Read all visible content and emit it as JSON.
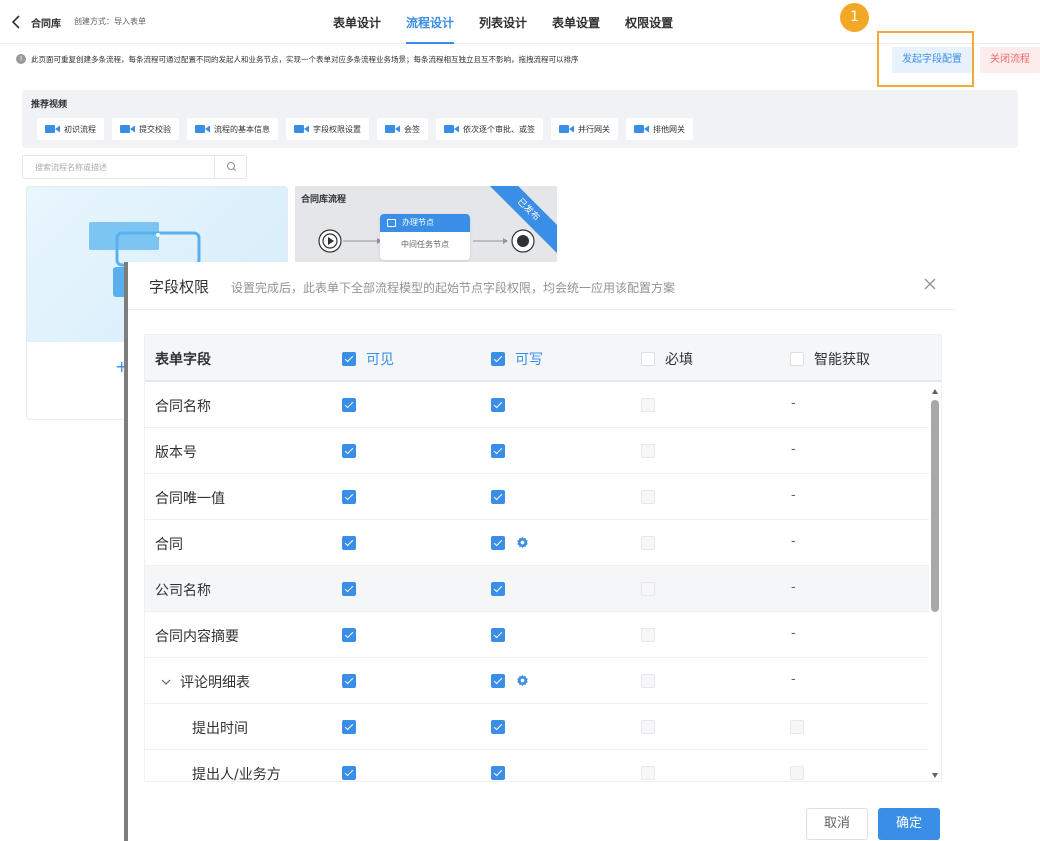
{
  "header": {
    "app_title": "合同库",
    "create_mode": "创建方式：导入表单",
    "tabs": [
      {
        "label": "表单设计",
        "active": false
      },
      {
        "label": "流程设计",
        "active": true
      },
      {
        "label": "列表设计",
        "active": false
      },
      {
        "label": "表单设置",
        "active": false
      },
      {
        "label": "权限设置",
        "active": false
      }
    ]
  },
  "notice": {
    "text": "此页面可重复创建多条流程，每条流程可通过配置不同的发起人和业务节点，实现一个表单对应多条流程业务场景；每条流程相互独立且互不影响，拖拽流程可以排序",
    "step_number": "1",
    "start_field_button": "发起字段配置",
    "close_flow_button": "关闭流程"
  },
  "videos": {
    "title": "推荐视频",
    "items": [
      "初识流程",
      "提交校验",
      "流程的基本信息",
      "字段权限设置",
      "会签",
      "依次逐个审批、或签",
      "并行网关",
      "排他网关"
    ]
  },
  "search": {
    "placeholder": "搜索流程名称或描述",
    "value": ""
  },
  "flow_card": {
    "title": "合同库流程",
    "ribbon": "已发布",
    "node_title": "办理节点",
    "node_body": "中间任务节点"
  },
  "modal": {
    "title": "字段权限",
    "description": "设置完成后，此表单下全部流程模型的起始节点字段权限，均会统一应用该配置方案",
    "columns": {
      "field": "表单字段",
      "visible": "可见",
      "writable": "可写",
      "required": "必填",
      "smart": "智能获取"
    },
    "header_checks": {
      "visible": true,
      "writable": true,
      "required": false,
      "smart": false
    },
    "rows": [
      {
        "name": "合同名称",
        "type": "field",
        "visible": true,
        "writable": true,
        "gear": false,
        "smart": "-"
      },
      {
        "name": "版本号",
        "type": "field",
        "visible": true,
        "writable": true,
        "gear": false,
        "smart": "-"
      },
      {
        "name": "合同唯一值",
        "type": "field",
        "visible": true,
        "writable": true,
        "gear": false,
        "smart": "-"
      },
      {
        "name": "合同",
        "type": "field",
        "visible": true,
        "writable": true,
        "gear": true,
        "smart": "-"
      },
      {
        "name": "公司名称",
        "type": "field",
        "visible": true,
        "writable": true,
        "gear": false,
        "smart": "-",
        "hover": true
      },
      {
        "name": "合同内容摘要",
        "type": "field",
        "visible": true,
        "writable": true,
        "gear": false,
        "smart": "-"
      },
      {
        "name": "评论明细表",
        "type": "group",
        "visible": true,
        "writable": true,
        "gear": true,
        "smart": "-"
      },
      {
        "name": "提出时间",
        "type": "child",
        "visible": true,
        "writable": true,
        "gear": false,
        "smart": "box"
      },
      {
        "name": "提出人/业务方",
        "type": "child",
        "visible": true,
        "writable": true,
        "gear": false,
        "smart": "box"
      }
    ],
    "cancel_button": "取消",
    "confirm_button": "确定"
  },
  "colors": {
    "primary": "#3a8ee6",
    "highlight": "#f3a93a",
    "badge": "#f2a825",
    "danger": "#f06a6a"
  }
}
